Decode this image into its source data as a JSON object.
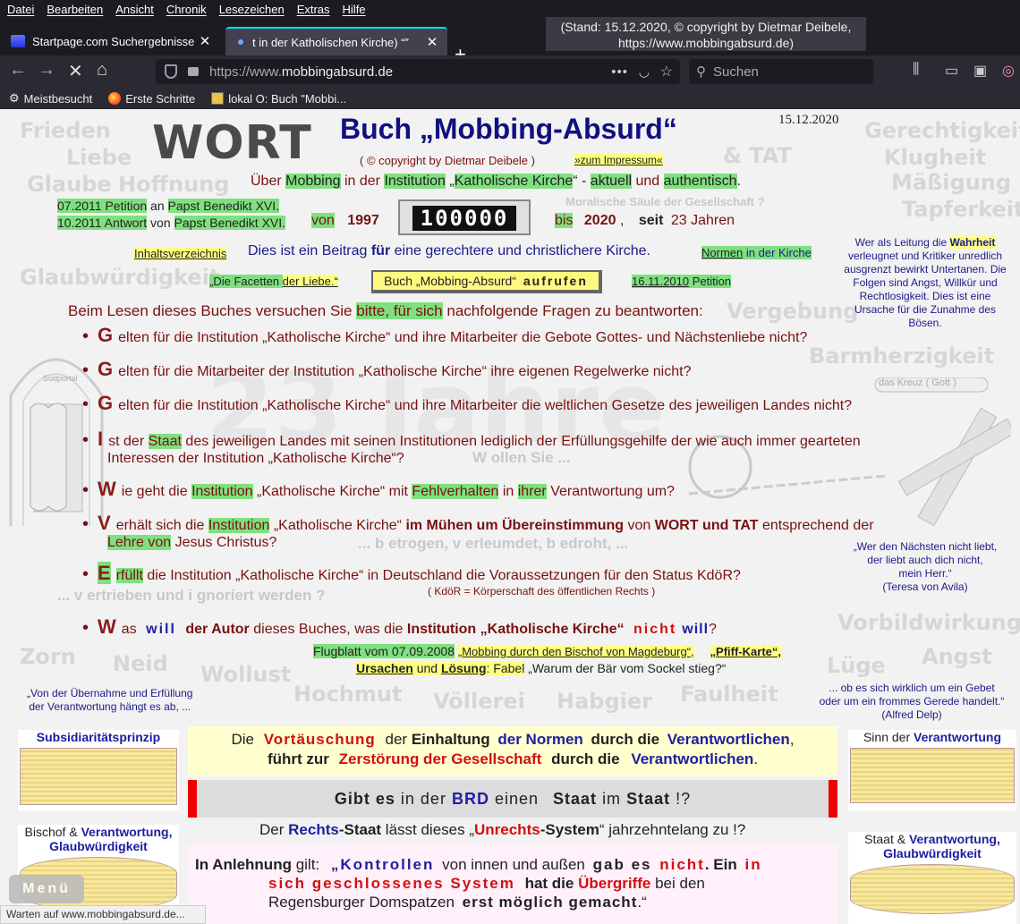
{
  "browser": {
    "menu": [
      "Datei",
      "Bearbeiten",
      "Ansicht",
      "Chronik",
      "Lesezeichen",
      "Extras",
      "Hilfe"
    ],
    "tabs": [
      {
        "title": "Startpage.com Suchergebnisse"
      },
      {
        "title": "t in der Katholischen Kirche) “”"
      }
    ],
    "tooltip_line1": "(Stand: 15.12.2020, © copyright by Dietmar Deibele,",
    "tooltip_line2": "https://www.mobbingabsurd.de)",
    "url_prefix": "https://www.",
    "url_domain": "mobbingabsurd.de",
    "search_placeholder": "Suchen",
    "bookmarks": [
      "Meistbesucht",
      "Erste Schritte",
      "lokal O: Buch \"Mobbi..."
    ],
    "status": "Warten auf www.mobbingabsurd.de..."
  },
  "page": {
    "date": "15.12.2020",
    "wort": "WORT",
    "tat": "& TAT",
    "title": "Buch „Mobbing-Absurd“",
    "copyright": "( © copyright by Dietmar Deibele )",
    "impressum": "»zum Impressum«",
    "about": {
      "t1": "Über",
      "t2": "Mobbing",
      "t3": "in der",
      "t4": "Institution",
      "t5": "„",
      "t6": "Katholische Kirche",
      "t7": "“ -",
      "t8": "aktuell",
      "t9": "und",
      "t10": "authentisch",
      "t11": "."
    },
    "subtitle_faint": "Moralische Säule der Gesellschaft ?",
    "petition1_a": "07.2011 Petition",
    "petition1_b": "an",
    "petition1_c": "Papst Benedikt XVI.",
    "petition2_a": "10.2011 Antwort",
    "petition2_b": "von",
    "petition2_c": "Papst Benedikt XVI.",
    "von": "von",
    "year_from": "1997",
    "counter": "100000",
    "bis": "bis",
    "year_to": "2020",
    "seit": "seit",
    "seit_years": "23 Jahren",
    "inhalt": "Inhaltsverzeichnis",
    "beitrag_a": "Dies ist ein Beitrag",
    "beitrag_b": "für",
    "beitrag_c": "eine gerechtere und christlichere Kirche.",
    "normen_a": "Normen",
    "normen_b": "in der Kirche",
    "facetten_a": "„Die Facetten",
    "facetten_b": "der Liebe.“",
    "book_button": "Buch „Mobbing-Absurd“",
    "book_button_b": "aufrufen",
    "pet_date": "16.11.2010",
    "pet_label": "Petition",
    "intro_a": "Beim Lesen dieses Buches versuchen Sie",
    "intro_b": "bitte, für sich",
    "intro_c": "nachfolgende Fragen zu beantworten:",
    "questions": [
      {
        "cap": "G",
        "text": "elten für die Institution „Katholische Kirche“ und ihre Mitarbeiter die Gebote Gottes- und Nächstenliebe nicht?"
      },
      {
        "cap": "G",
        "text": "elten für die Mitarbeiter der Institution „Katholische Kirche“ ihre eigenen Regelwerke nicht?"
      },
      {
        "cap": "G",
        "text": "elten für die Institution „Katholische Kirche“ und ihre Mitarbeiter die weltlichen Gesetze des jeweiligen Landes nicht?"
      }
    ],
    "q4": {
      "cap": "I",
      "a": "st der",
      "b": "Staat",
      "c": "des jeweiligen Landes mit seinen Institutionen lediglich der Erfüllungsgehilfe der wie auch immer gearteten",
      "d": "Interessen der Institution „Katholische Kirche“?"
    },
    "q5": {
      "cap": "W",
      "a": "ie geht die",
      "b": "Institution",
      "c": "„Katholische Kirche“ mit",
      "d": "Fehlverhalten",
      "e": "in",
      "f": "ihrer",
      "g": "Verantwortung um?"
    },
    "q6": {
      "cap": "V",
      "a": "erhält sich die",
      "b": "Institution",
      "c": "„Katholische Kirche“",
      "d": "im Mühen um Übereinstimmung",
      "e": "von",
      "f": "WORT und TAT",
      "g": "entsprechend der",
      "h": "Lehre von",
      "i": "Jesus Christus?"
    },
    "q7": {
      "cap": "E",
      "a": "rfüllt",
      "b": "die Institution „Katholische Kirche“ in Deutschland die Voraussetzungen für den Status KdöR?",
      "note": "( KdöR = Körperschaft des öffentlichen Rechts )"
    },
    "q8": {
      "cap": "W",
      "a": "as",
      "b": "will",
      "c": "der Autor",
      "d": "dieses Buches, was die",
      "e": "Institution „Katholische Kirche“",
      "f": "nicht",
      "g": "will",
      "h": "?"
    },
    "wollen": "W ollen Sie ...",
    "betrogen": "... b etrogen,  v erleumdet,  b edroht, ...",
    "vertrieben": "... v ertrieben und i gnoriert werden ?",
    "flugblatt": "Flugblatt vom 07.09.2008",
    "mobbing_bischof": "„Mobbing durch den Bischof von Magdeburg“,",
    "pfiff": "„Pfiff-Karte“,",
    "ursachen_a": "Ursachen",
    "ursachen_b": "und",
    "ursachen_c": "Lösung",
    "ursachen_d": ": Fabel",
    "ursachen_e": "„Warum der Bär vom Sockel stieg?“",
    "left_quote": [
      "„Von der Übernahme und Erfüllung",
      "der Verantwortung hängt es ab, ..."
    ],
    "right_quote1": [
      "Wer als Leitung die",
      "Wahrheit",
      "verleugnet und Kritiker unredlich",
      "ausgrenzt bewirkt Untertanen. Die",
      "Folgen sind Angst, Willkür und",
      "Rechtlosigkeit. Dies ist eine",
      "Ursache für die Zunahme des",
      "Bösen."
    ],
    "right_quote2": [
      "„Wer den Nächsten nicht liebt,",
      "der liebt auch dich nicht,",
      "mein Herr.“",
      "(Teresa von Avila)"
    ],
    "right_quote3": [
      "... ob es sich wirklich um ein Gebet",
      "oder um ein frommes Gerede handelt.“",
      "(Alfred Delp)"
    ],
    "watermarks": {
      "left": [
        "Frieden",
        "Liebe",
        "Glaube",
        "Hoffnung",
        "Glaubwürdigkeit"
      ],
      "right": [
        "Gerechtigkeit",
        "Klugheit",
        "Mäßigung",
        "Tapferkeit",
        "Vergebung",
        "Barmherzigkeit",
        "Vorbildwirkung",
        "Angst",
        "Lüge"
      ],
      "sins": [
        "Zorn",
        "Neid",
        "Wollust",
        "Hochmut",
        "Völlerei",
        "Habgier",
        "Faulheit"
      ],
      "big": "23 Jahre",
      "kreuz": "das Kreuz ( Gott )",
      "sudportal": "Südportal"
    },
    "subsid": "Subsidiaritätsprinzip",
    "sinn_a": "Sinn der",
    "sinn_b": "Verantwortung",
    "bischof_a": "Bischof &",
    "bischof_b": "Verantwortung,",
    "bischof_c": "Glaubwürdigkeit",
    "staat_a": "Staat &",
    "staat_b": "Verantwortung,",
    "staat_c": "Glaubwürdigkeit",
    "box1": {
      "a": "Die",
      "b": "Vortäuschung",
      "c": "der",
      "d": "Einhaltung",
      "e": "der Normen",
      "f": "durch die",
      "g": "Verantwortlichen",
      "h": ",",
      "i": "führt zur",
      "j": "Zerstörung der Gesellschaft",
      "k": "durch die",
      "l": "Verantwortlichen",
      "m": "."
    },
    "box2": {
      "a": "Gibt es",
      "b": "in der",
      "c": "BRD",
      "d": "einen",
      "e": "Staat",
      "f": "im",
      "g": "Staat",
      "h": "!?"
    },
    "rechts": {
      "a": "Der",
      "b": "Rechts",
      "c": "-Staat",
      "d": "lässt dieses „",
      "e": "Unrechts",
      "f": "-System",
      "g": "“ jahrzehntelang zu !?"
    },
    "box3": {
      "a": "In Anlehnung",
      "b": "gilt:",
      "c": "„Kontrollen",
      "d": "von innen und außen",
      "e": "gab es",
      "f": "nicht",
      "g": ". Ein",
      "h": "in",
      "i": "sich geschlossenes System",
      "j": "hat die",
      "k": "Übergriffe",
      "l": "bei den",
      "m": "Regensburger Domspatzen",
      "n": "erst möglich gemacht",
      "o": ".“"
    },
    "menu_button": "Menü"
  }
}
